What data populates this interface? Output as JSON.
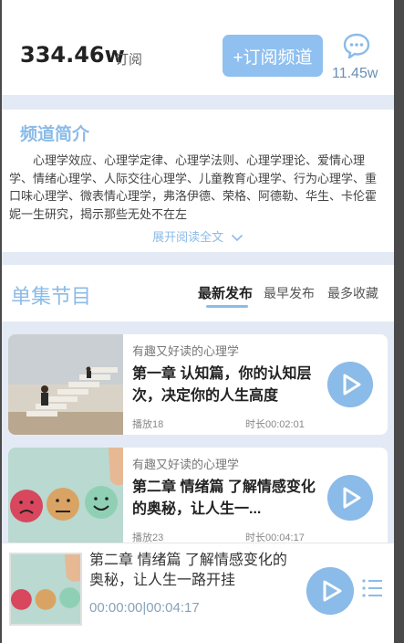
{
  "stats": {
    "subscribers": "334.46w",
    "subscribers_label": "订阅",
    "subscribe_button": "+订阅频道",
    "comment_icon": "comment-bubble-icon",
    "comments": "11.45w"
  },
  "intro": {
    "title": "频道简介",
    "text": "心理学效应、心理学定律、心理学法则、心理学理论、爱情心理学、情绪心理学、人际交往心理学、儿童教育心理学、行为心理学、重口味心理学、微表情心理学，弗洛伊德、荣格、阿德勒、华生、卡伦霍妮一生研究，揭示那些无处不在左",
    "expand": "展开阅读全文"
  },
  "episodes_header": {
    "title": "单集节目",
    "tabs": [
      "最新发布",
      "最早发布",
      "最多收藏"
    ],
    "active_tab": 0
  },
  "episodes": [
    {
      "album": "有趣又好读的心理学",
      "title": "第一章 认知篇，你的认知层次，决定你的人生高度",
      "plays": "播放18",
      "duration": "时长00:02:01"
    },
    {
      "album": "有趣又好读的心理学",
      "title": "第二章 情绪篇 了解情感变化的奥秘，让人生一...",
      "plays": "播放23",
      "duration": "时长00:04:17"
    }
  ],
  "player": {
    "title": "第二章 情绪篇 了解情感变化的奥秘，让人生一路开挂",
    "current": "00:00:00",
    "separator": "|",
    "total": "00:04:17"
  },
  "colors": {
    "accent": "#8bbbe8",
    "button": "#8fc0f0",
    "page_bg": "#e3eaf5"
  }
}
